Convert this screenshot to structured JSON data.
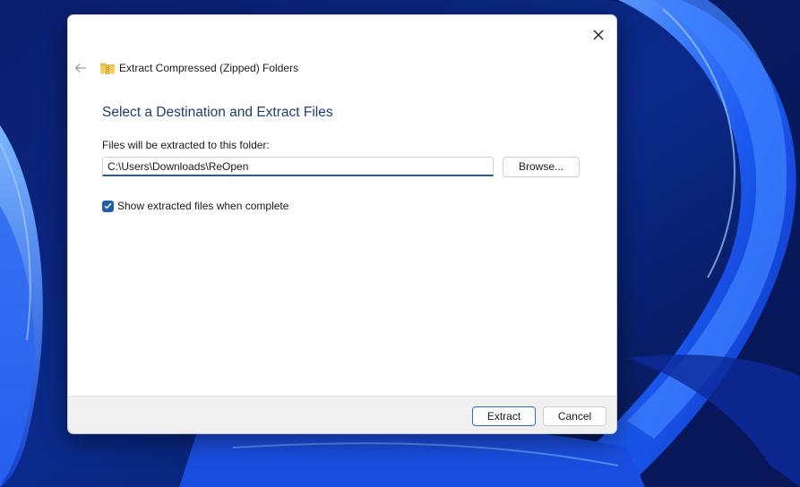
{
  "dialog": {
    "title": "Extract Compressed (Zipped) Folders",
    "heading": "Select a Destination and Extract Files",
    "path_label": "Files will be extracted to this folder:",
    "path_value": "C:\\Users\\Downloads\\ReOpen",
    "browse_label": "Browse...",
    "show_files_label": "Show extracted files when complete",
    "show_files_checked": true,
    "extract_label": "Extract",
    "cancel_label": "Cancel"
  },
  "icons": {
    "close": "close-icon",
    "back": "back-arrow-icon",
    "folder": "zipped-folder-icon",
    "checkmark": "checkmark-icon"
  },
  "colors": {
    "accent": "#1e5ea8",
    "heading": "#1f3d6e",
    "wallpaper_base": "#0a1a5c"
  }
}
